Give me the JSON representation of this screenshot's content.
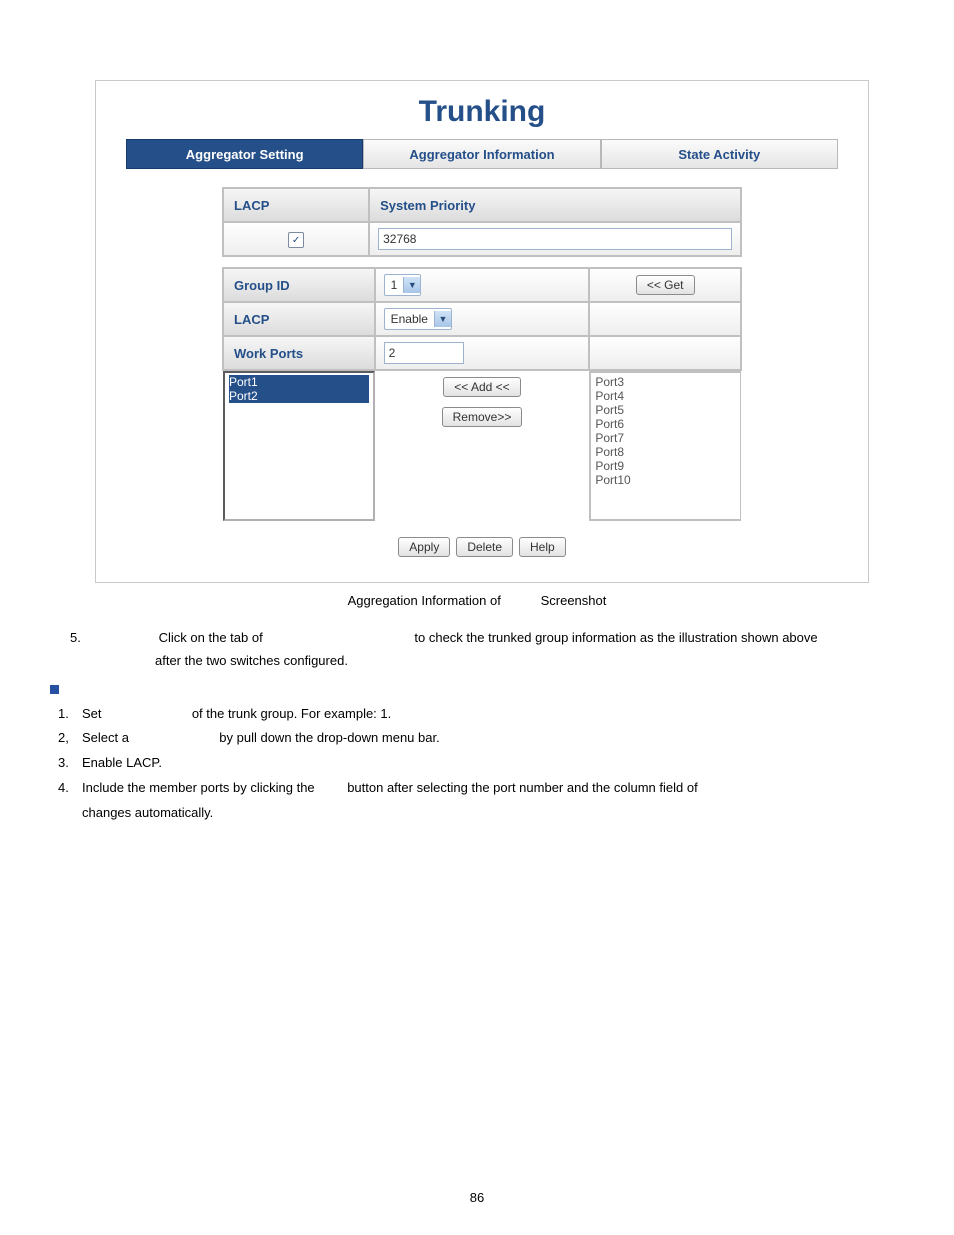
{
  "ui": {
    "title": "Trunking",
    "tabs": [
      "Aggregator Setting",
      "Aggregator Information",
      "State Activity"
    ],
    "active_tab": 0,
    "lacp_label": "LACP",
    "sys_prio_label": "System Priority",
    "sys_prio_value": "32768",
    "group_id_label": "Group ID",
    "group_id_value": "1",
    "get_button": "<< Get",
    "lacp_row_label": "LACP",
    "lacp_select": "Enable",
    "work_ports_label": "Work Ports",
    "work_ports_value": "2",
    "left_ports": [
      "Port1",
      "Port2"
    ],
    "right_ports": [
      "Port3",
      "Port4",
      "Port5",
      "Port6",
      "Port7",
      "Port8",
      "Port9",
      "Port10"
    ],
    "add_button": "<< Add <<",
    "remove_button": "Remove>>",
    "bottom_buttons": [
      "Apply",
      "Delete",
      "Help"
    ]
  },
  "caption_parts": {
    "a": "Aggregation Information of ",
    "b": " Screenshot"
  },
  "step5": {
    "num": "5.",
    "a": "Click on the tab of ",
    "b": " to check the trunked group information as the illustration shown above",
    "c": "after the two switches configured."
  },
  "subhead": " ",
  "steps": [
    {
      "num": "1.",
      "a": "Set ",
      "b": " of the trunk group. For example: 1."
    },
    {
      "num": "2,",
      "a": "Select a ",
      "b": " by pull down the drop-down menu bar."
    },
    {
      "num": "3.",
      "a": "Enable LACP.",
      "b": ""
    },
    {
      "num": "4.",
      "a": "Include the member ports by clicking the ",
      "b": " button after selecting the port number and the column field of ",
      "c": "changes automatically."
    }
  ],
  "page_number": "86"
}
